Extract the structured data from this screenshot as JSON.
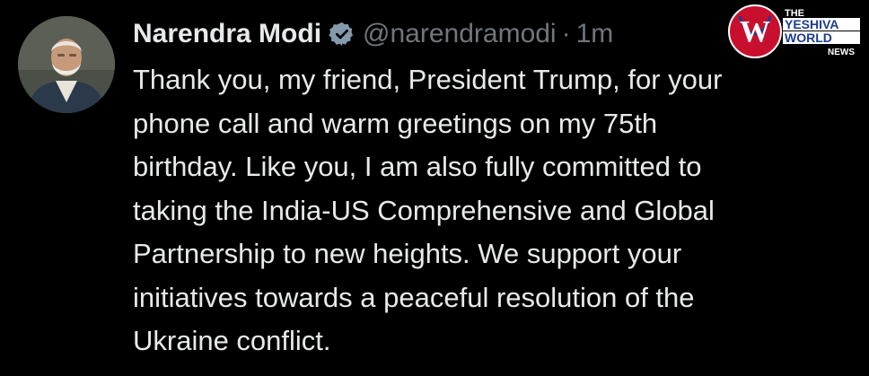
{
  "tweet": {
    "author_name": "Narendra Modi",
    "handle": "@narendramodi",
    "separator": "·",
    "timestamp": "1m",
    "text_lines": [
      "Thank you, my friend, President Trump, for your",
      "phone call and warm greetings on my 75th",
      "birthday. Like you, I am also fully committed to",
      "taking the India-US Comprehensive and Global",
      "Partnership to new heights. We support your",
      "initiatives towards a peaceful resolution of the",
      "Ukraine conflict."
    ]
  },
  "watermark": {
    "line1": "THE",
    "line2": "YESHIVA",
    "line3": "WORLD",
    "line4": "NEWS",
    "letter": "W"
  },
  "colors": {
    "background": "#000000",
    "text": "#e7e9ea",
    "secondary": "#71767b",
    "verified_badge": "#829aab",
    "logo_red": "#c8102e",
    "logo_blue": "#1d3c8f"
  }
}
